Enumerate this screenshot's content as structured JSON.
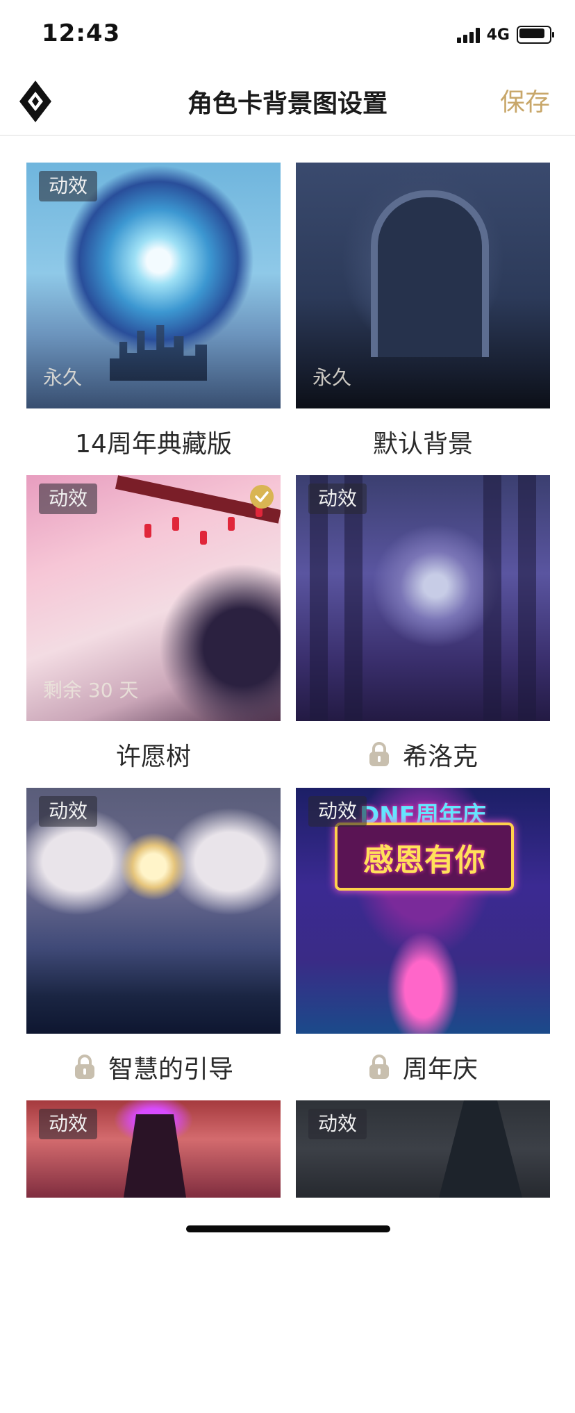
{
  "status_bar": {
    "time": "12:43",
    "network": "4G"
  },
  "header": {
    "title": "角色卡背景图设置",
    "save_label": "保存"
  },
  "cards": [
    {
      "title": "14周年典藏版",
      "badge": "动效",
      "duration": "永久",
      "locked": false,
      "selected": false
    },
    {
      "title": "默认背景",
      "badge": "",
      "duration": "永久",
      "locked": false,
      "selected": false
    },
    {
      "title": "许愿树",
      "badge": "动效",
      "duration": "剩余 30 天",
      "locked": false,
      "selected": true
    },
    {
      "title": "希洛克",
      "badge": "动效",
      "duration": "",
      "locked": true,
      "selected": false
    },
    {
      "title": "智慧的引导",
      "badge": "动效",
      "duration": "",
      "locked": true,
      "selected": false
    },
    {
      "title": "周年庆",
      "badge": "动效",
      "duration": "",
      "locked": true,
      "selected": false,
      "banner_top": "DNF周年庆",
      "banner_main": "感恩有你"
    },
    {
      "badge": "动效"
    },
    {
      "badge": "动效"
    }
  ],
  "colors": {
    "accent": "#c8a76a",
    "selected": "#d9b553",
    "lock": "#c8bfae"
  },
  "icons": {
    "logo": "diamond-logo-icon",
    "lock": "lock-icon",
    "check": "check-icon"
  }
}
